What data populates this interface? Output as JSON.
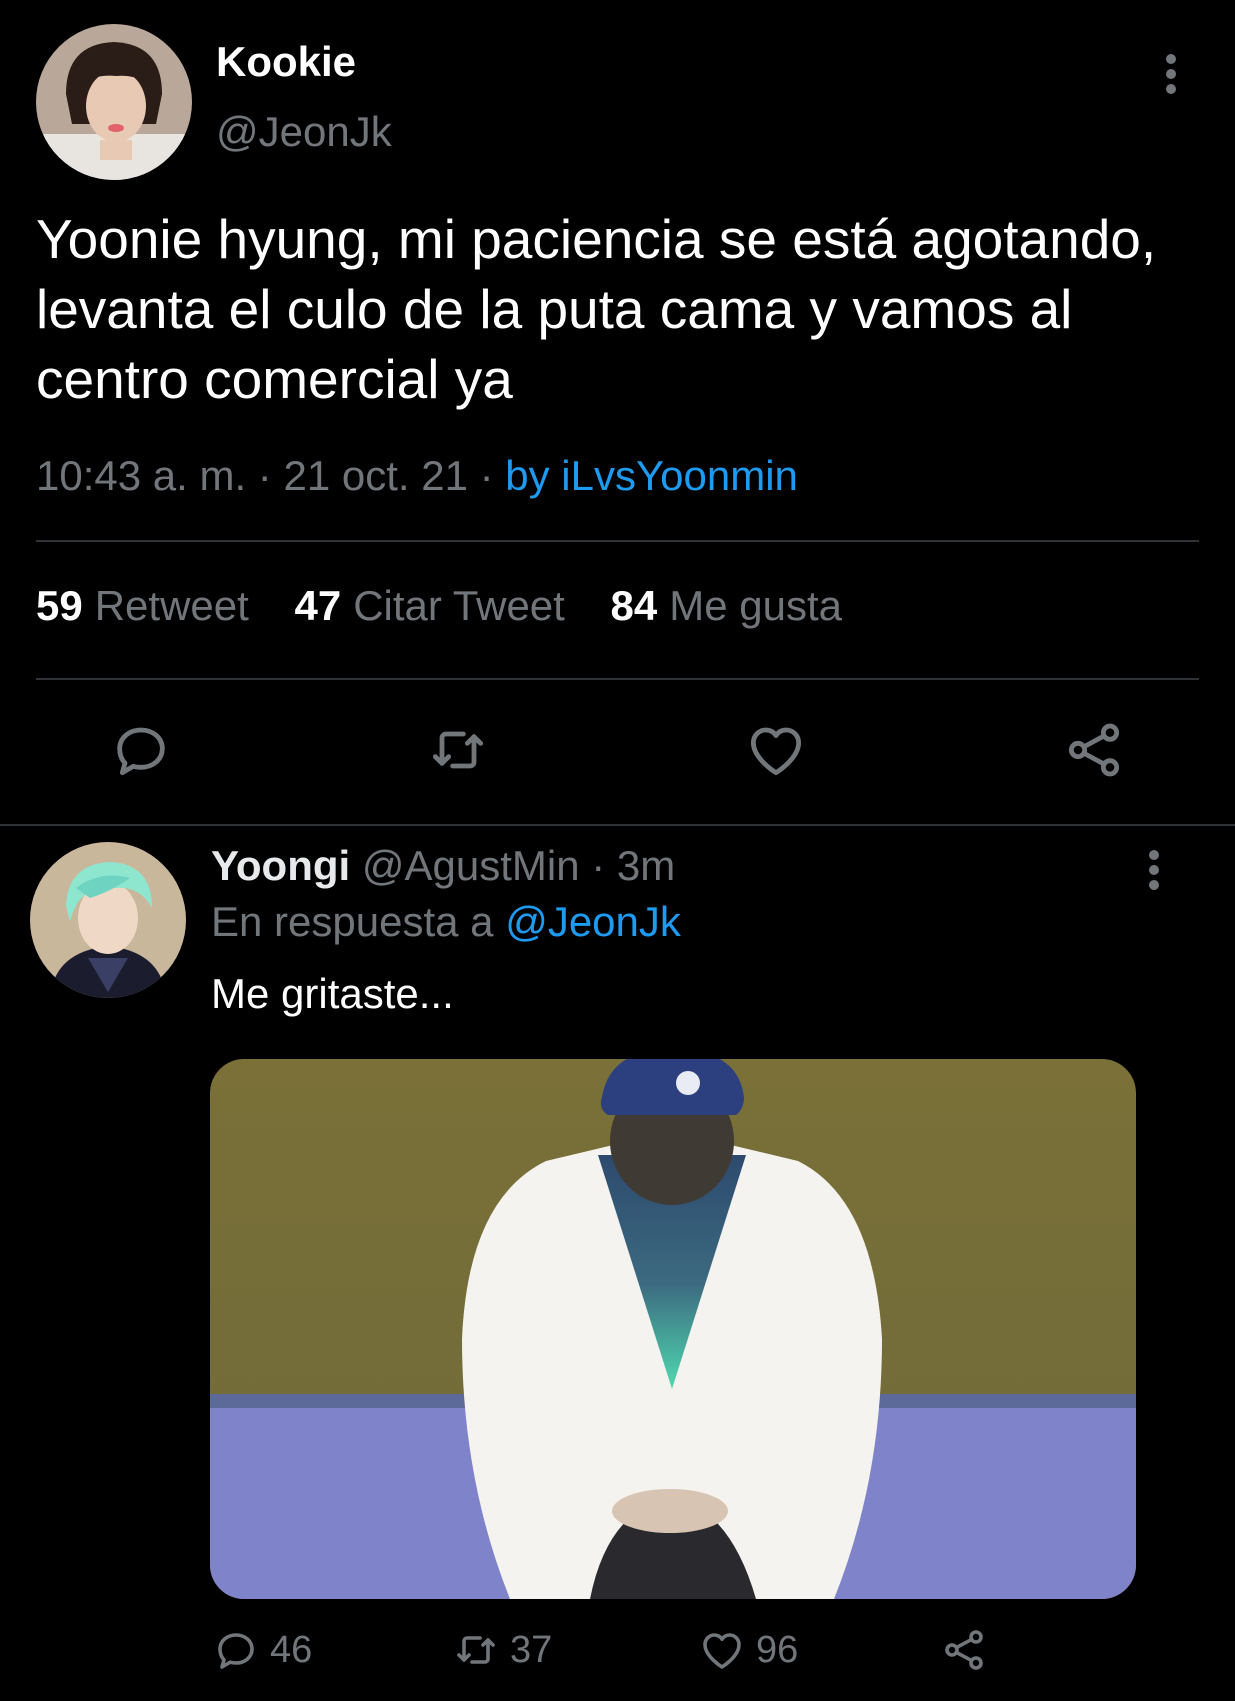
{
  "main_tweet": {
    "author_name": "Kookie",
    "author_handle": "@JeonJk",
    "text": "Yoonie hyung, mi paciencia se está agotando, levanta el culo de la puta cama y vamos al centro comercial ya",
    "time": "10:43 a. m.",
    "separator": "·",
    "date": "21 oct. 21",
    "source": "by iLvsYoonmin",
    "stats": {
      "retweets_count": "59",
      "retweets_label": "Retweet",
      "quotes_count": "47",
      "quotes_label": "Citar Tweet",
      "likes_count": "84",
      "likes_label": "Me gusta"
    },
    "actions": {
      "reply_icon": "reply-icon",
      "retweet_icon": "retweet-icon",
      "like_icon": "heart-icon",
      "share_icon": "share-icon"
    }
  },
  "reply_tweet": {
    "author_name": "Yoongi",
    "author_handle": "@AgustMin",
    "separator": "·",
    "time": "3m",
    "reply_to_prefix": "En respuesta a",
    "reply_to_handle": "@JeonJk",
    "text": "Me gritaste...",
    "counts": {
      "replies": "46",
      "retweets": "37",
      "likes": "96"
    }
  },
  "colors": {
    "background": "#000000",
    "text": "#e7e9ea",
    "muted": "#71767b",
    "link": "#1d9bf0",
    "divider": "#2f3336"
  }
}
